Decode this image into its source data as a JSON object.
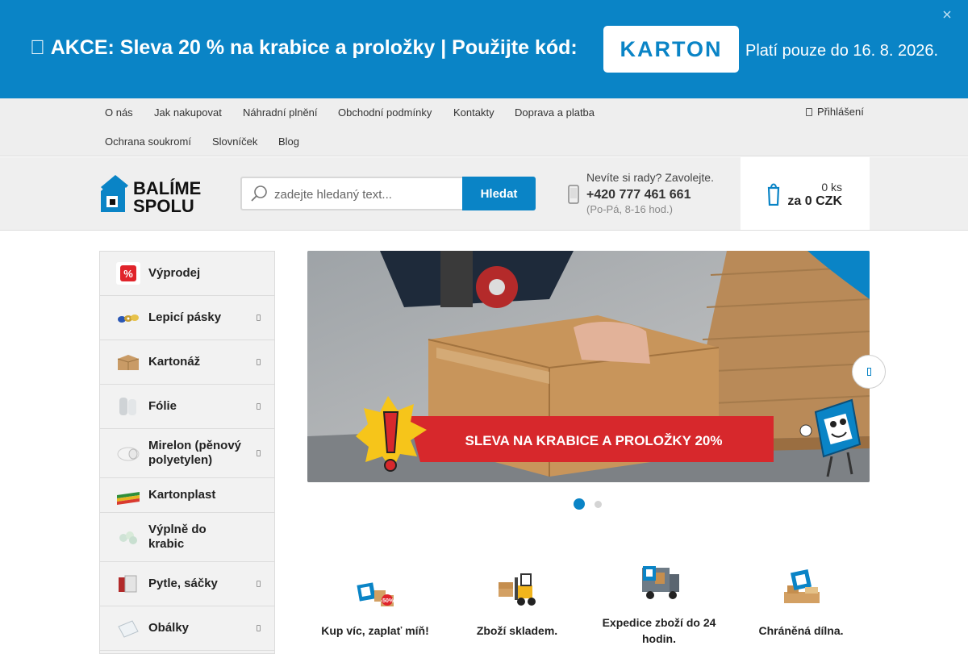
{
  "promo": {
    "icon": "tag-icon",
    "message": " AKCE: Sleva 20 % na krabice a proložky | Použijte kód:",
    "code": "KARTON",
    "valid_until": "Platí pouze do 16. 8. 2026.",
    "close_icon": "close-icon",
    "background": "#0a84c6"
  },
  "topnav": {
    "links": [
      "O nás",
      "Jak nakupovat",
      "Náhradní plnění",
      "Obchodní podmínky",
      "Kontakty",
      "Doprava a platba",
      "Ochrana soukromí",
      "Slovníček",
      "Blog"
    ],
    "login_label": "Přihlášení",
    "login_icon": "lock-icon"
  },
  "header": {
    "logo_line1": "BALÍME",
    "logo_line2": "SPOLU",
    "search_placeholder": "zadejte hledaný text...",
    "search_button": "Hledat",
    "help_text": "Nevíte si rady? Zavolejte.",
    "phone": "+420 777 461 661",
    "hours": "(Po-Pá, 8-16 hod.)",
    "cart_qty": "0 ks",
    "cart_price": "za 0 CZK",
    "accent": "#0a84c6"
  },
  "categories": [
    {
      "label": "Výprodej",
      "icon": "sale-percent-icon",
      "has_submenu": false
    },
    {
      "label": "Lepicí pásky",
      "icon": "tape-rolls-icon",
      "has_submenu": true
    },
    {
      "label": "Kartonáž",
      "icon": "cardboard-box-icon",
      "has_submenu": true
    },
    {
      "label": "Fólie",
      "icon": "foil-roll-icon",
      "has_submenu": true
    },
    {
      "label": "Mirelon (pěnový polyetylen)",
      "icon": "foam-roll-icon",
      "has_submenu": true
    },
    {
      "label": "Kartonplast",
      "icon": "kartonplast-sheets-icon",
      "has_submenu": false
    },
    {
      "label": "Výplně do krabic",
      "icon": "box-fill-icon",
      "has_submenu": false
    },
    {
      "label": "Pytle, sáčky",
      "icon": "bags-icon",
      "has_submenu": true
    },
    {
      "label": "Obálky",
      "icon": "envelope-icon",
      "has_submenu": true
    }
  ],
  "hero": {
    "banner_text": "SLEVA NA  KRABICE A PROLOŽKY 20%",
    "slides": 2,
    "active_slide": 1
  },
  "benefits": [
    {
      "label": "Kup víc, zaplať míň!",
      "icon": "discount-boxes-icon"
    },
    {
      "label": "Zboží skladem.",
      "icon": "forklift-icon"
    },
    {
      "label": "Expedice zboží do 24 hodin.",
      "icon": "delivery-van-icon"
    },
    {
      "label": "Chráněná dílna.",
      "icon": "workshop-icon"
    }
  ]
}
